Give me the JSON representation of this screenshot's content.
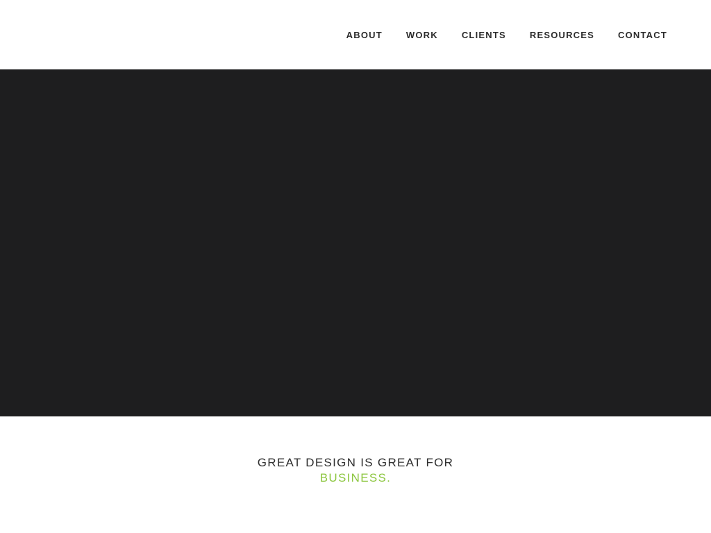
{
  "nav": {
    "items": [
      {
        "label": "ABOUT"
      },
      {
        "label": "WORK"
      },
      {
        "label": "CLIENTS"
      },
      {
        "label": "RESOURCES"
      },
      {
        "label": "CONTACT"
      }
    ]
  },
  "tagline": {
    "line1": "GREAT DESIGN IS GREAT FOR",
    "line2": "BUSINESS."
  },
  "colors": {
    "hero_background": "#1e1e1f",
    "accent": "#8cc63f",
    "text": "#2b2b2b"
  }
}
